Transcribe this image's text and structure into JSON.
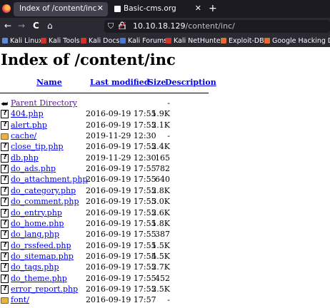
{
  "browser": {
    "active_tab": {
      "title": "Index of /content/inc",
      "close": "✕"
    },
    "inactive_tab": {
      "title": "Basic-cms.org",
      "close": "✕"
    },
    "new_tab": "+",
    "nav": {
      "back": "←",
      "forward": "→",
      "reload": "C",
      "home": "⌂"
    },
    "url": {
      "host": "10.10.18.129",
      "path": "/content/inc/",
      "shield": "⛉",
      "lock": "🔓"
    },
    "bookmarks": [
      {
        "label": "Kali Linux",
        "color": "#5b8bd8"
      },
      {
        "label": "Kali Tools",
        "color": "#d0342c"
      },
      {
        "label": "Kali Docs",
        "color": "#d0342c"
      },
      {
        "label": "Kali Forums",
        "color": "#4a7bd0"
      },
      {
        "label": "Kali NetHunter",
        "color": "#d0342c"
      },
      {
        "label": "Exploit-DB",
        "color": "#e86a2c"
      },
      {
        "label": "Google Hacking DB",
        "color": "#e86a2c"
      }
    ]
  },
  "listing": {
    "title": "Index of /content/inc",
    "headers": {
      "name": "Name",
      "modified": "Last modified",
      "size": "Size",
      "description": "Description"
    },
    "rows": [
      {
        "name": "Parent Directory",
        "date": "",
        "size": "-",
        "type": "parent"
      },
      {
        "name": "404.php",
        "date": "2016-09-19 17:55",
        "size": "1.9K",
        "type": "file"
      },
      {
        "name": "alert.php",
        "date": "2016-09-19 17:55",
        "size": "2.1K",
        "type": "file"
      },
      {
        "name": "cache/",
        "date": "2019-11-29 12:30",
        "size": "-",
        "type": "folder"
      },
      {
        "name": "close_tip.php",
        "date": "2016-09-19 17:55",
        "size": "2.4K",
        "type": "file"
      },
      {
        "name": "db.php",
        "date": "2019-11-29 12:30",
        "size": "165",
        "type": "file"
      },
      {
        "name": "do_ads.php",
        "date": "2016-09-19 17:55",
        "size": "782",
        "type": "file"
      },
      {
        "name": "do_attachment.php",
        "date": "2016-09-19 17:55",
        "size": "640",
        "type": "file"
      },
      {
        "name": "do_category.php",
        "date": "2016-09-19 17:55",
        "size": "2.8K",
        "type": "file"
      },
      {
        "name": "do_comment.php",
        "date": "2016-09-19 17:55",
        "size": "3.0K",
        "type": "file"
      },
      {
        "name": "do_entry.php",
        "date": "2016-09-19 17:55",
        "size": "2.6K",
        "type": "file"
      },
      {
        "name": "do_home.php",
        "date": "2016-09-19 17:55",
        "size": "1.8K",
        "type": "file"
      },
      {
        "name": "do_lang.php",
        "date": "2016-09-19 17:55",
        "size": "387",
        "type": "file"
      },
      {
        "name": "do_rssfeed.php",
        "date": "2016-09-19 17:55",
        "size": "1.5K",
        "type": "file"
      },
      {
        "name": "do_sitemap.php",
        "date": "2016-09-19 17:55",
        "size": "4.5K",
        "type": "file"
      },
      {
        "name": "do_tags.php",
        "date": "2016-09-19 17:55",
        "size": "2.7K",
        "type": "file"
      },
      {
        "name": "do_theme.php",
        "date": "2016-09-19 17:55",
        "size": "452",
        "type": "file"
      },
      {
        "name": "error_report.php",
        "date": "2016-09-19 17:55",
        "size": "2.5K",
        "type": "file"
      },
      {
        "name": "font/",
        "date": "2016-09-19 17:57",
        "size": "-",
        "type": "folder"
      }
    ]
  }
}
